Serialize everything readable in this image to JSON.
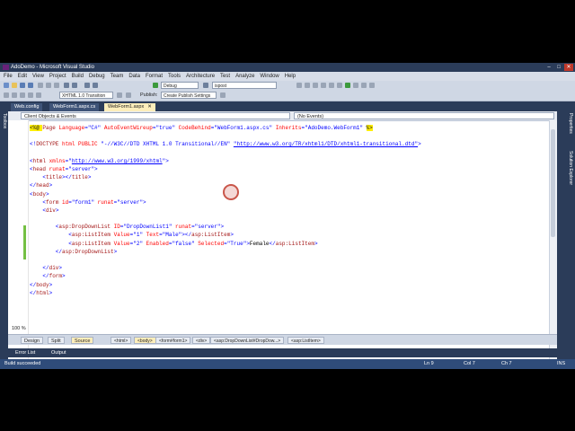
{
  "window": {
    "title": "AdoDemo - Microsoft Visual Studio",
    "buttons": [
      "–",
      "□",
      "✕"
    ]
  },
  "menu": [
    "File",
    "Edit",
    "View",
    "Project",
    "Build",
    "Debug",
    "Team",
    "Data",
    "Format",
    "Tools",
    "Architecture",
    "Test",
    "Analyze",
    "Window",
    "Help"
  ],
  "toolbar": {
    "config": "Debug",
    "search": "ispost",
    "doctype": "XHTML 1.0 Transition",
    "publish_label": "Publish:",
    "publish_setting": "Create Publish Settings"
  },
  "tabs": [
    {
      "label": "Web.config",
      "active": false
    },
    {
      "label": "WebForm1.aspx.cs",
      "active": false
    },
    {
      "label": "WebForm1.aspx",
      "active": true,
      "close": "✕"
    }
  ],
  "side": {
    "toolbox": "Toolbox",
    "properties": "Properties",
    "solution_explorer": "Solution Explorer"
  },
  "navbar": {
    "left": "Client Objects & Events",
    "right": "(No Events)"
  },
  "code": {
    "l1": {
      "a": "<%@ ",
      "b": "Page ",
      "c": "Language",
      "d": "=\"C#\" ",
      "e": "AutoEventWireup",
      "f": "=\"true\" ",
      "g": "CodeBehind",
      "h": "=\"WebForm1.aspx.cs\" ",
      "i": "Inherits",
      "j": "=\"AdoDemo.WebForm1\" ",
      "k": "%>"
    },
    "l3": {
      "a": "<!",
      "b": "DOCTYPE ",
      "c": "html ",
      "d": "PUBLIC ",
      "e": "\"-//W3C//DTD XHTML 1.0 Transitional//EN\" ",
      "f": "\"http://www.w3.org/TR/xhtml1/DTD/xhtml1-transitional.dtd\"",
      "g": ">"
    },
    "l5": {
      "a": "<",
      "b": "html ",
      "c": "xmlns",
      "d": "=\"",
      "e": "http://www.w3.org/1999/xhtml",
      "f": "\">"
    },
    "l6": {
      "a": "<",
      "b": "head ",
      "c": "runat",
      "d": "=\"server\">"
    },
    "l7": {
      "a": "    <",
      "b": "title",
      "c": "></",
      "d": "title",
      "e": ">"
    },
    "l8": {
      "a": "</",
      "b": "head",
      "c": ">"
    },
    "l9": {
      "a": "<",
      "b": "body",
      "c": ">"
    },
    "l10": {
      "a": "    <",
      "b": "form ",
      "c": "id",
      "d": "=\"form1\" ",
      "e": "runat",
      "f": "=\"server\">"
    },
    "l11": {
      "a": "    <",
      "b": "div",
      "c": ">"
    },
    "l13": {
      "a": "        <",
      "b": "asp:DropDownList ",
      "c": "ID",
      "d": "=\"DropDownList1\" ",
      "e": "runat",
      "f": "=\"server\">"
    },
    "l14": {
      "a": "            <",
      "b": "asp:ListItem ",
      "c": "Value",
      "d": "=\"1\" ",
      "e": "Text",
      "f": "=\"Male\"",
      "g": "></",
      "h": "asp:ListItem",
      "i": ">"
    },
    "l15": {
      "a": "            <",
      "b": "asp:ListItem ",
      "c": "Value",
      "d": "=\"2\" ",
      "e": "Enabled",
      "f": "=\"false\" ",
      "g": "Selected",
      "h": "=\"True\"",
      "i": ">",
      "j": "Female",
      "k": "</",
      "l": "asp:ListItem",
      "m": ">"
    },
    "l16": {
      "a": "        </",
      "b": "asp:DropDownList",
      "c": ">"
    },
    "l18": {
      "a": "    </",
      "b": "div",
      "c": ">"
    },
    "l19": {
      "a": "    </",
      "b": "form",
      "c": ">"
    },
    "l20": {
      "a": "</",
      "b": "body",
      "c": ">"
    },
    "l21": {
      "a": "</",
      "b": "html",
      "c": ">"
    }
  },
  "editor": {
    "zoom": "100 %"
  },
  "viewbar": {
    "design": "Design",
    "split": "Split",
    "source": "Source",
    "crumbs": [
      "<html>",
      "<body>",
      "<form#form1>",
      "<div>",
      "<asp:DropDownList#DropDow...>",
      "<asp:ListItem>"
    ]
  },
  "bottom_tabs": [
    "Error List",
    "Output"
  ],
  "status": {
    "message": "Build succeeded",
    "ln": "Ln 9",
    "col": "Col 7",
    "ch": "Ch 7",
    "mode": "INS"
  },
  "colors": {
    "chrome": "#2b3c59",
    "active_tab": "#fdeebb",
    "status": "#2f4c7a"
  }
}
